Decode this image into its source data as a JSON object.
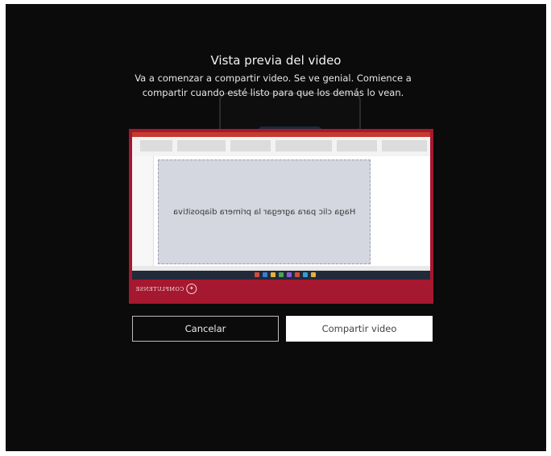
{
  "dialog": {
    "title": "Vista previa del video",
    "message": "Va a comenzar a compartir video. Se ve genial. Comience a compartir cuando esté listo para que los demás lo vean."
  },
  "preview": {
    "slide_placeholder": "Haga clic para agregar la primera diapositiva",
    "logo_text": "COMPLUTENSE"
  },
  "buttons": {
    "cancel_label": "Cancelar",
    "share_label": "Compartir video"
  },
  "colors": {
    "overlay": "#0b0b0b",
    "preview_border": "#a6182f",
    "slide_bg": "#d4d6e0"
  }
}
